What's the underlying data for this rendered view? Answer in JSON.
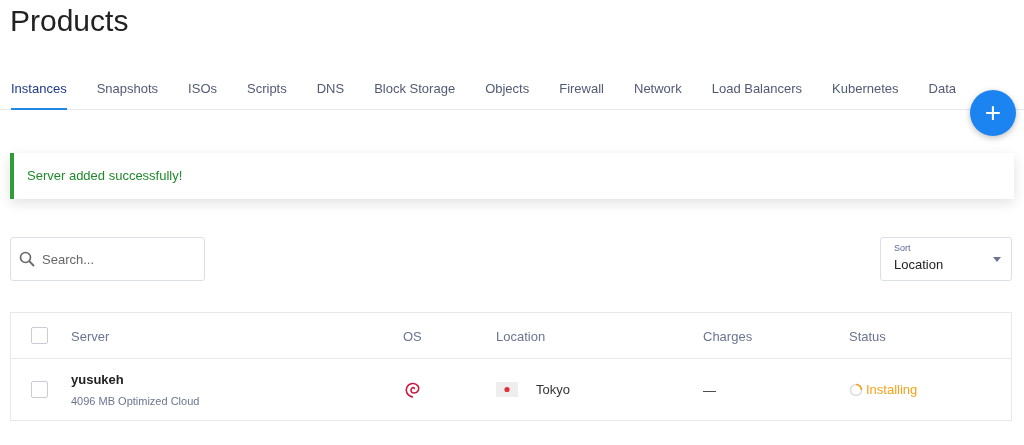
{
  "page": {
    "title": "Products"
  },
  "tabs": [
    {
      "label": "Instances",
      "selected": true
    },
    {
      "label": "Snapshots",
      "selected": false
    },
    {
      "label": "ISOs",
      "selected": false
    },
    {
      "label": "Scripts",
      "selected": false
    },
    {
      "label": "DNS",
      "selected": false
    },
    {
      "label": "Block Storage",
      "selected": false
    },
    {
      "label": "Objects",
      "selected": false
    },
    {
      "label": "Firewall",
      "selected": false
    },
    {
      "label": "Network",
      "selected": false
    },
    {
      "label": "Load Balancers",
      "selected": false
    },
    {
      "label": "Kubernetes",
      "selected": false
    },
    {
      "label": "Data",
      "selected": false
    }
  ],
  "add_button": {
    "label": "+"
  },
  "alert": {
    "message": "Server added successfully!"
  },
  "search": {
    "placeholder": "Search..."
  },
  "sort": {
    "label": "Sort",
    "value": "Location"
  },
  "table": {
    "columns": [
      "Server",
      "OS",
      "Location",
      "Charges",
      "Status"
    ],
    "header_checked": false,
    "rows": [
      {
        "checked": false,
        "name": "yusukeh",
        "plan": "4096 MB Optimized Cloud",
        "location": "Tokyo",
        "charges": "—",
        "status": "Installing"
      }
    ]
  }
}
